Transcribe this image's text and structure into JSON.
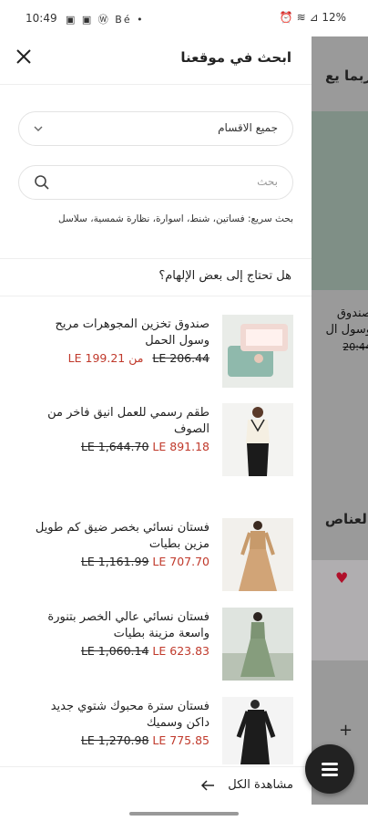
{
  "status_bar": {
    "time": "10:49",
    "notifications": "▣ ▣ Ⓦ Bé •",
    "right": "⏰ ≋ ⊿ 12%"
  },
  "background_page": {
    "title": "ربما يع",
    "product_name": "صندوق",
    "product_name2": "وسول ال",
    "price": "20:44",
    "section": "العناص"
  },
  "drawer": {
    "title": "ابحث في موقعنا",
    "category_select": {
      "value": "جميع الاقسام"
    },
    "search": {
      "placeholder": "بحث"
    },
    "quick_search": "بحث سريع: فساتين، شنط، اسوارة، نظارة شمسية، سلاسل",
    "inspiration_heading": "هل تحتاج إلى بعض الإلهام؟",
    "products": [
      {
        "name": "صندوق تخزين المجوهرات مريح وسول الحمل",
        "old_price": "LE 206.44",
        "new_price": "من LE 199.21"
      },
      {
        "name": "طقم رسمي للعمل انيق فاخر من الصوف",
        "old_price": "LE 1,644.70",
        "new_price": "LE 891.18"
      },
      {
        "name": "فستان نسائي بخصر ضيق كم طويل مزين بطيات",
        "old_price": "LE 1,161.99",
        "new_price": "LE 707.70"
      },
      {
        "name": "فستان نسائي عالي الخصر بتنورة واسعة مزينة بطيات",
        "old_price": "LE 1,060.14",
        "new_price": "LE 623.83"
      },
      {
        "name": "فستان سترة محبوك شتوي جديد داكن وسميك",
        "old_price": "LE 1,270.98",
        "new_price": "LE 775.85"
      }
    ],
    "view_all": "مشاهدة الكل"
  }
}
